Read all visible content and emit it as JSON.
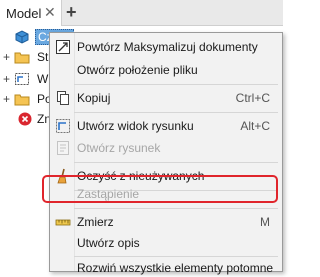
{
  "tabbar": {
    "tab_label": "Model",
    "close_glyph": "✕",
    "add_glyph": "+"
  },
  "tree": {
    "items": [
      {
        "label": "Część",
        "icon": "part-icon",
        "expander": ""
      },
      {
        "label": "Sta",
        "icon": "folder-icon",
        "expander": "+"
      },
      {
        "label": "Wi",
        "icon": "view-icon",
        "expander": "+"
      },
      {
        "label": "Po",
        "icon": "folder-icon",
        "expander": "+"
      },
      {
        "label": "Zn",
        "icon": "error-icon",
        "expander": ""
      }
    ]
  },
  "menu": {
    "items": [
      {
        "label": "Powtórz Maksymalizuj dokumenty",
        "shortcut": "",
        "icon": "maximize-icon",
        "enabled": true
      },
      {
        "label": "Otwórz położenie pliku",
        "shortcut": "",
        "icon": "",
        "enabled": true
      },
      {
        "label": "Kopiuj",
        "shortcut": "Ctrl+C",
        "icon": "copy-icon",
        "enabled": true
      },
      {
        "label": "Utwórz widok rysunku",
        "shortcut": "Alt+C",
        "icon": "drawing-view-icon",
        "enabled": true
      },
      {
        "label": "Otwórz rysunek",
        "shortcut": "",
        "icon": "open-drawing-icon",
        "enabled": false
      },
      {
        "label": "Oczyść z nieużywanych",
        "shortcut": "",
        "icon": "broom-icon",
        "enabled": true
      },
      {
        "label": "Zastąpienie",
        "shortcut": "",
        "icon": "",
        "enabled": false
      },
      {
        "label": "Zmierz",
        "shortcut": "M",
        "icon": "measure-icon",
        "enabled": true
      },
      {
        "label": "Utwórz opis",
        "shortcut": "",
        "icon": "",
        "enabled": true
      },
      {
        "label": "Rozwiń wszystkie elementy potomne",
        "shortcut": "",
        "icon": "",
        "enabled": true
      }
    ]
  },
  "colors": {
    "highlight": "#e0252c",
    "selection": "#6aa8e0"
  }
}
